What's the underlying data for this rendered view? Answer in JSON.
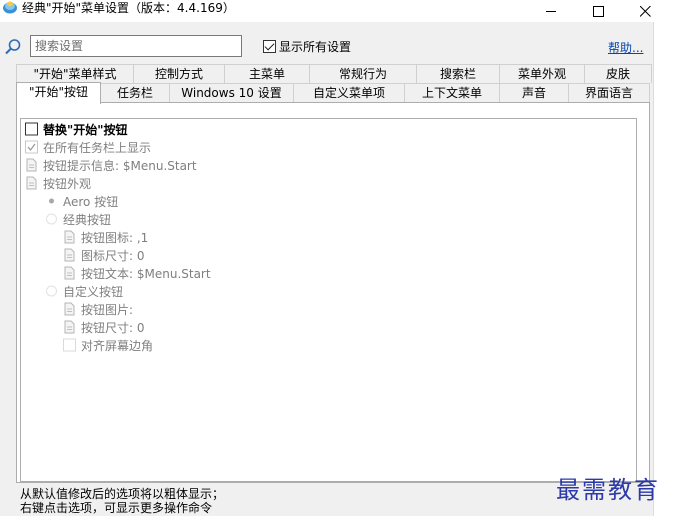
{
  "window": {
    "title": "经典\"开始\"菜单设置（版本：4.4.169）",
    "minimize": "minimize",
    "maximize": "maximize",
    "close": "close"
  },
  "search": {
    "placeholder": "搜索设置",
    "value": ""
  },
  "show_all_settings": {
    "label": "显示所有设置",
    "checked": true
  },
  "help_link": "帮助...",
  "tabs_top": [
    {
      "label": "\"开始\"菜单样式"
    },
    {
      "label": "控制方式"
    },
    {
      "label": "主菜单"
    },
    {
      "label": "常规行为"
    },
    {
      "label": "搜索栏"
    },
    {
      "label": "菜单外观"
    },
    {
      "label": "皮肤"
    }
  ],
  "tabs_bottom": [
    {
      "label": "\"开始\"按钮",
      "active": true
    },
    {
      "label": "任务栏"
    },
    {
      "label": "Windows 10 设置"
    },
    {
      "label": "自定义菜单项"
    },
    {
      "label": "上下文菜单"
    },
    {
      "label": "声音"
    },
    {
      "label": "界面语言"
    }
  ],
  "tree_items": [
    {
      "label": "替换\"开始\"按钮",
      "type": "checkbox",
      "checked": false,
      "style": "bold"
    },
    {
      "label": "在所有任务栏上显示",
      "type": "checkbox",
      "checked": true,
      "style": "gray"
    },
    {
      "label": "按钮提示信息: $Menu.Start",
      "type": "doc",
      "style": "gray"
    },
    {
      "label": "按钮外观",
      "type": "doc",
      "style": "gray"
    },
    {
      "label": "Aero 按钮",
      "type": "radio",
      "selected": true,
      "style": "gray"
    },
    {
      "label": "经典按钮",
      "type": "radio",
      "selected": false,
      "style": "gray"
    },
    {
      "label": "按钮图标: ,1",
      "type": "doc",
      "style": "gray"
    },
    {
      "label": "图标尺寸: 0",
      "type": "doc",
      "style": "gray"
    },
    {
      "label": "按钮文本: $Menu.Start",
      "type": "doc",
      "style": "gray"
    },
    {
      "label": "自定义按钮",
      "type": "radio",
      "selected": false,
      "style": "gray"
    },
    {
      "label": "按钮图片:",
      "type": "doc",
      "style": "gray"
    },
    {
      "label": "按钮尺寸: 0",
      "type": "doc",
      "style": "gray"
    },
    {
      "label": "对齐屏幕边角",
      "type": "checkbox",
      "checked": false,
      "style": "gray"
    }
  ],
  "status": {
    "line1": "从默认值修改后的选项将以粗体显示；",
    "line2": "右键点击选项，可显示更多操作命令"
  },
  "watermark": "最需教育",
  "colors": {
    "link": "#0645ad",
    "watermark": "#2b3aa8",
    "disabled_text": "#7f7f7f"
  },
  "icons": [
    "app-shell-icon",
    "search-icon",
    "doc-icon",
    "checkbox",
    "radio"
  ]
}
